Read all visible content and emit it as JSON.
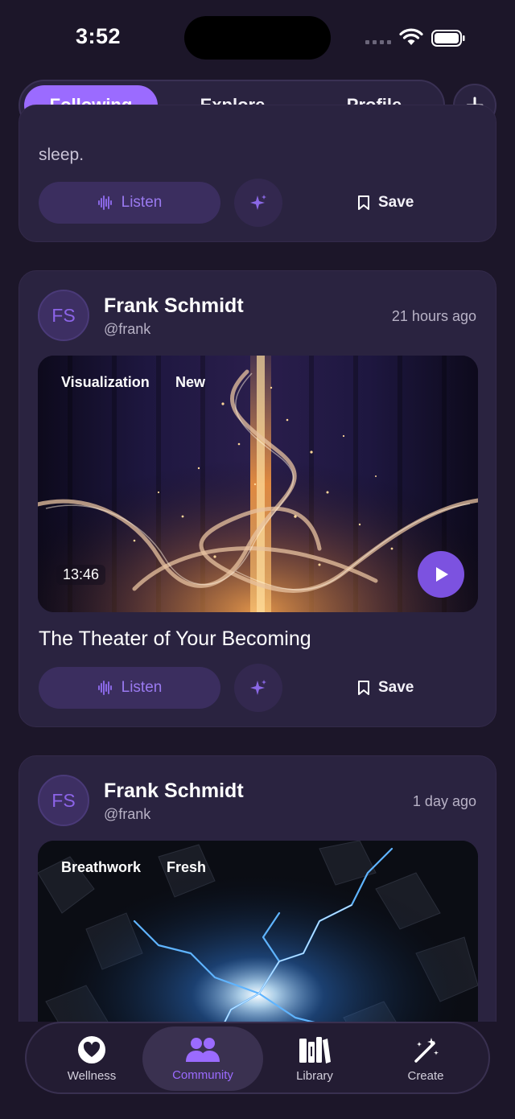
{
  "status_bar": {
    "time": "3:52"
  },
  "top_tabs": [
    {
      "label": "Following",
      "active": true
    },
    {
      "label": "Explore",
      "active": false
    },
    {
      "label": "Profile",
      "active": false
    }
  ],
  "add_button": {
    "icon": "plus-icon"
  },
  "posts": [
    {
      "snippet": "sleep.",
      "actions": {
        "listen": "Listen",
        "save": "Save"
      }
    },
    {
      "avatar_initials": "FS",
      "author": "Frank Schmidt",
      "handle": "@frank",
      "time": "21 hours ago",
      "tags": [
        "Visualization",
        "New"
      ],
      "duration": "13:46",
      "title": "The Theater of Your Becoming",
      "actions": {
        "listen": "Listen",
        "save": "Save"
      }
    },
    {
      "avatar_initials": "FS",
      "author": "Frank Schmidt",
      "handle": "@frank",
      "time": "1 day ago",
      "tags": [
        "Breathwork",
        "Fresh"
      ]
    }
  ],
  "bottom_nav": [
    {
      "label": "Wellness",
      "icon": "heart-icon",
      "active": false
    },
    {
      "label": "Community",
      "icon": "people-icon",
      "active": true
    },
    {
      "label": "Library",
      "icon": "books-icon",
      "active": false
    },
    {
      "label": "Create",
      "icon": "magic-wand-icon",
      "active": false
    }
  ],
  "colors": {
    "background": "#1c1629",
    "card": "#2a2340",
    "accent": "#9b6bff",
    "listen_button": "#3b2e5f"
  }
}
